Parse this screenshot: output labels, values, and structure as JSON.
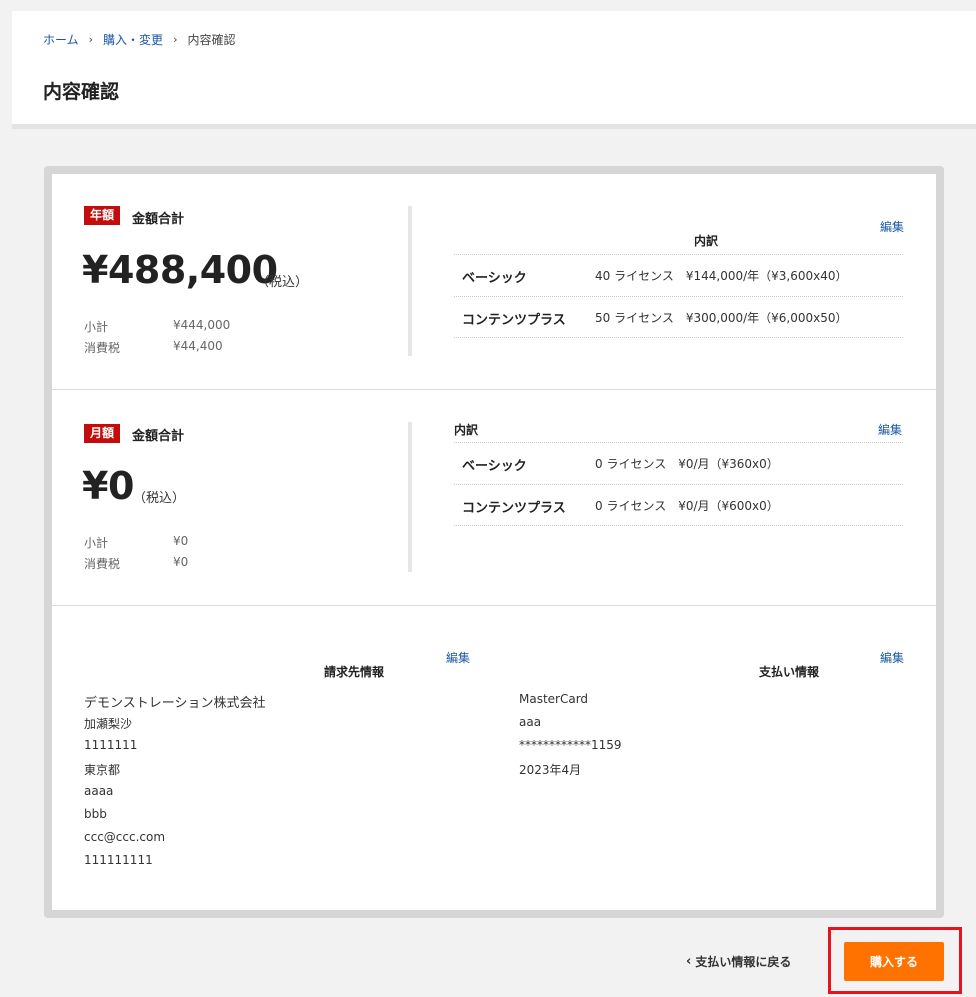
{
  "breadcrumb": {
    "home": "ホーム",
    "purchase": "購入・変更",
    "current": "内容確認"
  },
  "page_title": "内容確認",
  "annual": {
    "tag": "年額",
    "label": "金額合計",
    "amount": "¥488,400",
    "tax_note": "（税込）",
    "subtotal_label": "小計",
    "subtotal_value": "¥444,000",
    "tax_label": "消費税",
    "tax_value": "¥44,400",
    "edit_label": "編集",
    "breakdown_title": "内訳",
    "rows": [
      {
        "name": "ベーシック",
        "detail": "40 ライセンス　¥144,000/年（¥3,600x40）"
      },
      {
        "name": "コンテンツプラス",
        "detail": "50 ライセンス　¥300,000/年（¥6,000x50）"
      }
    ]
  },
  "monthly": {
    "tag": "月額",
    "label": "金額合計",
    "amount": "¥0",
    "tax_note": "（税込）",
    "subtotal_label": "小計",
    "subtotal_value": "¥0",
    "tax_label": "消費税",
    "tax_value": "¥0",
    "edit_label": "編集",
    "breakdown_title": "内訳",
    "rows": [
      {
        "name": "ベーシック",
        "detail": "0 ライセンス　¥0/月（¥360x0）"
      },
      {
        "name": "コンテンツプラス",
        "detail": "0 ライセンス　¥0/月（¥600x0）"
      }
    ]
  },
  "billing": {
    "title": "請求先情報",
    "edit_label": "編集",
    "lines": [
      "デモンストレーション株式会社",
      "加瀬梨沙",
      "1111111",
      "東京都",
      "aaaa",
      "bbb",
      "ccc@ccc.com",
      "111111111"
    ]
  },
  "payment": {
    "title": "支払い情報",
    "edit_label": "編集",
    "lines": [
      "MasterCard",
      "aaa",
      "************1159",
      "2023年4月"
    ]
  },
  "footer": {
    "back_label": "支払い情報に戻る",
    "buy_label": "購入する"
  },
  "colors": {
    "accent": "#ff7200",
    "tag_red": "#c30d0d",
    "link_blue": "#1a57a6",
    "highlight": "#e8141d"
  }
}
